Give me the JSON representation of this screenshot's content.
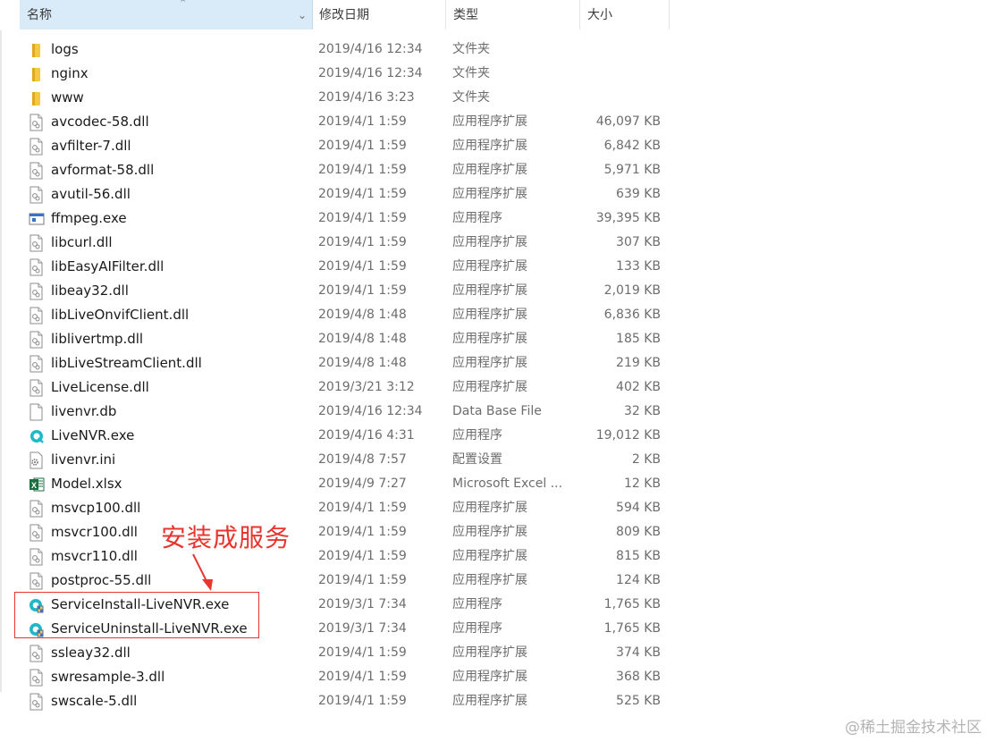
{
  "columns": {
    "name": "名称",
    "date": "修改日期",
    "type": "类型",
    "size": "大小"
  },
  "files": [
    {
      "name": "logs",
      "date": "2019/4/16 12:34",
      "type": "文件夹",
      "size": "",
      "icon": "folder-icon"
    },
    {
      "name": "nginx",
      "date": "2019/4/16 12:34",
      "type": "文件夹",
      "size": "",
      "icon": "folder-icon"
    },
    {
      "name": "www",
      "date": "2019/4/16 3:23",
      "type": "文件夹",
      "size": "",
      "icon": "folder-icon"
    },
    {
      "name": "avcodec-58.dll",
      "date": "2019/4/1 1:59",
      "type": "应用程序扩展",
      "size": "46,097 KB",
      "icon": "dll-file-icon"
    },
    {
      "name": "avfilter-7.dll",
      "date": "2019/4/1 1:59",
      "type": "应用程序扩展",
      "size": "6,842 KB",
      "icon": "dll-file-icon"
    },
    {
      "name": "avformat-58.dll",
      "date": "2019/4/1 1:59",
      "type": "应用程序扩展",
      "size": "5,971 KB",
      "icon": "dll-file-icon"
    },
    {
      "name": "avutil-56.dll",
      "date": "2019/4/1 1:59",
      "type": "应用程序扩展",
      "size": "639 KB",
      "icon": "dll-file-icon"
    },
    {
      "name": "ffmpeg.exe",
      "date": "2019/4/1 1:59",
      "type": "应用程序",
      "size": "39,395 KB",
      "icon": "exe-window-icon"
    },
    {
      "name": "libcurl.dll",
      "date": "2019/4/1 1:59",
      "type": "应用程序扩展",
      "size": "307 KB",
      "icon": "dll-file-icon"
    },
    {
      "name": "libEasyAIFilter.dll",
      "date": "2019/4/1 1:59",
      "type": "应用程序扩展",
      "size": "133 KB",
      "icon": "dll-file-icon"
    },
    {
      "name": "libeay32.dll",
      "date": "2019/4/1 1:59",
      "type": "应用程序扩展",
      "size": "2,019 KB",
      "icon": "dll-file-icon"
    },
    {
      "name": "libLiveOnvifClient.dll",
      "date": "2019/4/8 1:48",
      "type": "应用程序扩展",
      "size": "6,836 KB",
      "icon": "dll-file-icon"
    },
    {
      "name": "liblivertmp.dll",
      "date": "2019/4/8 1:48",
      "type": "应用程序扩展",
      "size": "185 KB",
      "icon": "dll-file-icon"
    },
    {
      "name": "libLiveStreamClient.dll",
      "date": "2019/4/8 1:48",
      "type": "应用程序扩展",
      "size": "219 KB",
      "icon": "dll-file-icon"
    },
    {
      "name": "LiveLicense.dll",
      "date": "2019/3/21 3:12",
      "type": "应用程序扩展",
      "size": "402 KB",
      "icon": "dll-file-icon"
    },
    {
      "name": "livenvr.db",
      "date": "2019/4/16 12:34",
      "type": "Data Base File",
      "size": "32 KB",
      "icon": "blank-file-icon"
    },
    {
      "name": "LiveNVR.exe",
      "date": "2019/4/16 4:31",
      "type": "应用程序",
      "size": "19,012 KB",
      "icon": "livenvr-app-icon"
    },
    {
      "name": "livenvr.ini",
      "date": "2019/4/8 7:57",
      "type": "配置设置",
      "size": "2 KB",
      "icon": "ini-settings-icon"
    },
    {
      "name": "Model.xlsx",
      "date": "2019/4/9 7:27",
      "type": "Microsoft Excel ...",
      "size": "12 KB",
      "icon": "excel-icon"
    },
    {
      "name": "msvcp100.dll",
      "date": "2019/4/1 1:59",
      "type": "应用程序扩展",
      "size": "594 KB",
      "icon": "dll-file-icon"
    },
    {
      "name": "msvcr100.dll",
      "date": "2019/4/1 1:59",
      "type": "应用程序扩展",
      "size": "809 KB",
      "icon": "dll-file-icon"
    },
    {
      "name": "msvcr110.dll",
      "date": "2019/4/1 1:59",
      "type": "应用程序扩展",
      "size": "815 KB",
      "icon": "dll-file-icon"
    },
    {
      "name": "postproc-55.dll",
      "date": "2019/4/1 1:59",
      "type": "应用程序扩展",
      "size": "124 KB",
      "icon": "dll-file-icon"
    },
    {
      "name": "ServiceInstall-LiveNVR.exe",
      "date": "2019/3/1 7:34",
      "type": "应用程序",
      "size": "1,765 KB",
      "icon": "service-app-icon"
    },
    {
      "name": "ServiceUninstall-LiveNVR.exe",
      "date": "2019/3/1 7:34",
      "type": "应用程序",
      "size": "1,765 KB",
      "icon": "service-app-icon"
    },
    {
      "name": "ssleay32.dll",
      "date": "2019/4/1 1:59",
      "type": "应用程序扩展",
      "size": "374 KB",
      "icon": "dll-file-icon"
    },
    {
      "name": "swresample-3.dll",
      "date": "2019/4/1 1:59",
      "type": "应用程序扩展",
      "size": "368 KB",
      "icon": "dll-file-icon"
    },
    {
      "name": "swscale-5.dll",
      "date": "2019/4/1 1:59",
      "type": "应用程序扩展",
      "size": "525 KB",
      "icon": "dll-file-icon"
    }
  ],
  "annotation": {
    "label": "安装成服务",
    "color": "#e8352d"
  },
  "watermark": "@稀土掘金技术社区",
  "colors": {
    "header_selected": "#d9ebf9",
    "folder": "#f4c842",
    "excel": "#1d6f42",
    "livenvr_teal": "#20b8c8"
  }
}
